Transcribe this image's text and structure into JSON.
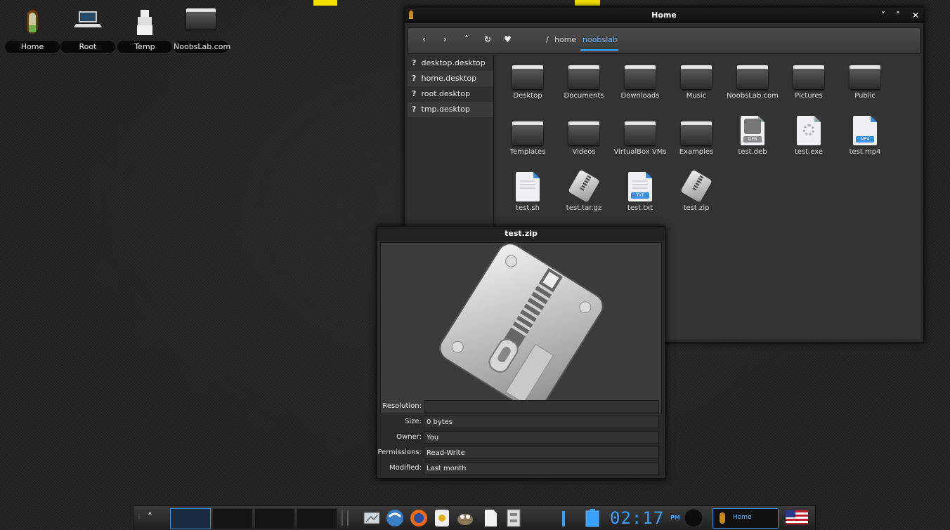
{
  "desktop": {
    "icons": [
      {
        "label": "Home",
        "icon": "home-door-icon"
      },
      {
        "label": "Root",
        "icon": "computer-icon"
      },
      {
        "label": "Temp",
        "icon": "trash-icon"
      },
      {
        "label": "NoobsLab.com",
        "icon": "folder-icon"
      }
    ]
  },
  "file_manager": {
    "title": "Home",
    "controls": {
      "minimize": "˅",
      "maximize": "˄",
      "close": "✕"
    },
    "toolbar": {
      "back": "‹",
      "forward": "›",
      "up": "˄",
      "reload": "↻",
      "bookmark": "♥",
      "path_root": "/",
      "path": [
        "home",
        "noobslab"
      ]
    },
    "sidebar": [
      "desktop.desktop",
      "home.desktop",
      "root.desktop",
      "tmp.desktop"
    ],
    "items": [
      {
        "name": "Desktop",
        "type": "folder"
      },
      {
        "name": "Documents",
        "type": "folder"
      },
      {
        "name": "Downloads",
        "type": "folder"
      },
      {
        "name": "Music",
        "type": "folder"
      },
      {
        "name": "NoobsLab.com",
        "type": "folder"
      },
      {
        "name": "Pictures",
        "type": "folder"
      },
      {
        "name": "Public",
        "type": "folder"
      },
      {
        "name": "Templates",
        "type": "folder"
      },
      {
        "name": "Videos",
        "type": "folder"
      },
      {
        "name": "VirtualBox VMs",
        "type": "folder"
      },
      {
        "name": "Examples",
        "type": "folder"
      },
      {
        "name": "test.deb",
        "type": "deb",
        "badge": "DEB"
      },
      {
        "name": "test.exe",
        "type": "exe"
      },
      {
        "name": "test.mp4",
        "type": "mp4",
        "badge": "MP4"
      },
      {
        "name": "test.sh",
        "type": "sh"
      },
      {
        "name": "test.tar.gz",
        "type": "archive"
      },
      {
        "name": "test.txt",
        "type": "txt",
        "badge": "TXT"
      },
      {
        "name": "test.zip",
        "type": "archive"
      }
    ]
  },
  "preview": {
    "title": "test.zip",
    "fields": [
      {
        "key": "Resolution:",
        "value": ""
      },
      {
        "key": "Size:",
        "value": "0 bytes"
      },
      {
        "key": "Owner:",
        "value": "You"
      },
      {
        "key": "Permissions:",
        "value": "Read-Write"
      },
      {
        "key": "Modified:",
        "value": "Last month"
      }
    ]
  },
  "taskbar": {
    "up_arrow": "˄",
    "clock": "02:17",
    "ampm": "PM",
    "task_home_label": "Home",
    "colors": {
      "accent": "#3aa0ff"
    }
  }
}
